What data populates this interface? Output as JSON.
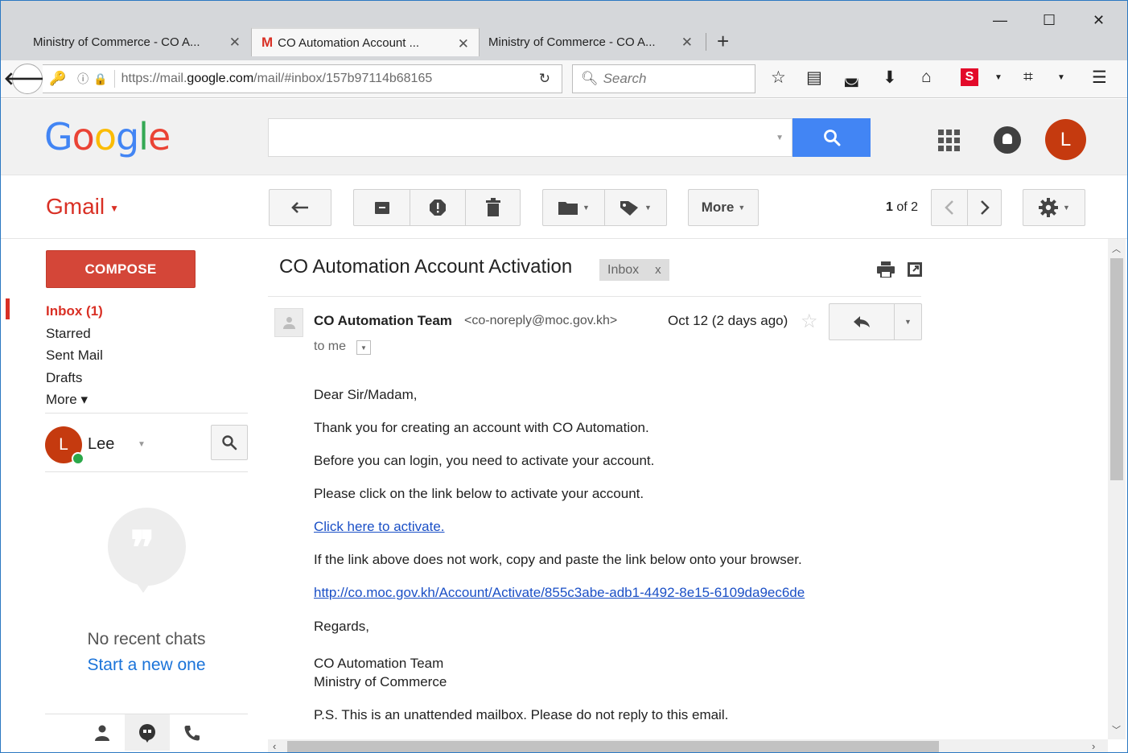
{
  "browser": {
    "tabs": [
      {
        "title": "Ministry of Commerce - CO A..."
      },
      {
        "title": "CO Automation Account ..."
      },
      {
        "title": "Ministry of Commerce - CO A..."
      }
    ],
    "url_prefix": "https://mail.",
    "url_domain": "google.com",
    "url_suffix": "/mail/#inbox/157b97114b68165",
    "search_placeholder": "Search"
  },
  "google": {
    "avatar_letter": "L"
  },
  "toolbar": {
    "more_label": "More",
    "paging_current": "1",
    "paging_rest": " of 2"
  },
  "gmail_label": "Gmail",
  "sidebar": {
    "compose_label": "COMPOSE",
    "items": [
      {
        "label": "Inbox (1)"
      },
      {
        "label": "Starred"
      },
      {
        "label": "Sent Mail"
      },
      {
        "label": "Drafts"
      },
      {
        "label": "More ▾"
      }
    ],
    "user_name": "Lee",
    "user_initial": "L",
    "no_chats": "No recent chats",
    "start_new": "Start a new one"
  },
  "message": {
    "subject": "CO Automation Account Activation",
    "label": "Inbox",
    "label_close": "x",
    "sender_name": "CO Automation Team",
    "sender_email": "<co-noreply@moc.gov.kh>",
    "date": "Oct 12 (2 days ago)",
    "to": "to me",
    "greeting": "Dear Sir/Madam,",
    "line1": "Thank you for creating an account with CO Automation.",
    "line2": "Before you can login, you need to activate your account.",
    "line3": "Please click on the link below to activate your account.",
    "activate_link": "Click here to activate.",
    "line4": "If the link above does not work, copy and paste the link below onto your browser.",
    "activation_url": "http://co.moc.gov.kh/Account/Activate/855c3abe-adb1-4492-8e15-6109da9ec6de",
    "regards": "Regards,",
    "signature1": "CO Automation Team",
    "signature2": "Ministry of Commerce",
    "ps": "P.S. This is an unattended mailbox. Please do not reply to this email."
  }
}
